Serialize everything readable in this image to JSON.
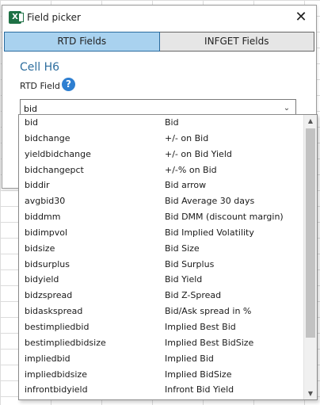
{
  "dialog": {
    "title": "Field picker",
    "close_label": "✕",
    "app_icon_letter": "X"
  },
  "tabs": [
    {
      "label": "RTD Fields",
      "active": true
    },
    {
      "label": "INFGET Fields",
      "active": false
    }
  ],
  "cell_ref": "Cell H6",
  "field_label": "RTD Field",
  "help_glyph": "?",
  "search": {
    "value": "bid",
    "chevron": "⌄"
  },
  "list": {
    "items": [
      {
        "name": "bid",
        "description": "Bid"
      },
      {
        "name": "bidchange",
        "description": "+/- on Bid"
      },
      {
        "name": "yieldbidchange",
        "description": "+/- on Bid Yield"
      },
      {
        "name": "bidchangepct",
        "description": "+/-% on Bid"
      },
      {
        "name": "biddir",
        "description": "Bid arrow"
      },
      {
        "name": "avgbid30",
        "description": "Bid Average 30 days"
      },
      {
        "name": "biddmm",
        "description": "Bid DMM (discount margin)"
      },
      {
        "name": "bidimpvol",
        "description": "Bid Implied Volatility"
      },
      {
        "name": "bidsize",
        "description": "Bid Size"
      },
      {
        "name": "bidsurplus",
        "description": "Bid Surplus"
      },
      {
        "name": "bidyield",
        "description": "Bid Yield"
      },
      {
        "name": "bidzspread",
        "description": "Bid Z-Spread"
      },
      {
        "name": "bidaskspread",
        "description": "Bid/Ask spread in %"
      },
      {
        "name": "bestimpliedbid",
        "description": "Implied Best Bid"
      },
      {
        "name": "bestimpliedbidsize",
        "description": "Implied Best BidSize"
      },
      {
        "name": "impliedbid",
        "description": "Implied Bid"
      },
      {
        "name": "impliedbidsize",
        "description": "Implied BidSize"
      },
      {
        "name": "infrontbidyield",
        "description": "Infront Bid Yield"
      }
    ]
  },
  "colors": {
    "active_tab": "#a9d2ef",
    "inactive_tab": "#e6e6e6",
    "cell_ref": "#2e6e9e",
    "help_icon": "#2e7fd1",
    "excel_green": "#1e7145"
  }
}
